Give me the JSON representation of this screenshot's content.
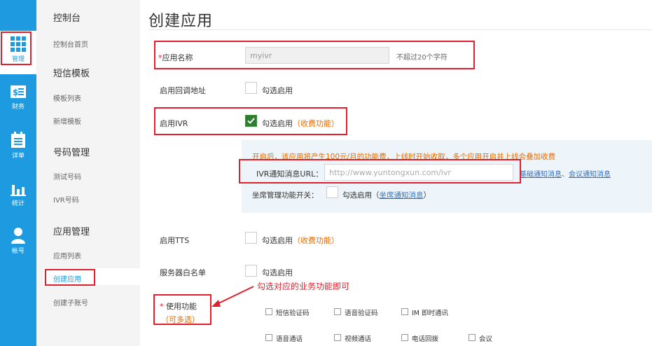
{
  "rail": {
    "items": [
      {
        "label": "管理",
        "icon": "grid-icon"
      },
      {
        "label": "财务",
        "icon": "bill-icon"
      },
      {
        "label": "详单",
        "icon": "list-icon"
      },
      {
        "label": "统计",
        "icon": "bar-chart-icon"
      },
      {
        "label": "帐号",
        "icon": "user-icon"
      }
    ]
  },
  "subnav": {
    "groups": [
      {
        "title": "控制台",
        "items": [
          "控制台首页"
        ]
      },
      {
        "title": "短信模板",
        "items": [
          "模板列表",
          "新增模板"
        ]
      },
      {
        "title": "号码管理",
        "items": [
          "测试号码",
          "IVR号码"
        ]
      },
      {
        "title": "应用管理",
        "items": [
          "应用列表",
          "创建应用",
          "创建子账号"
        ]
      }
    ]
  },
  "page": {
    "title": "创建应用"
  },
  "form": {
    "app_name": {
      "req": "*",
      "label": "应用名称",
      "value": "myivr",
      "hint": "不超过20个字符"
    },
    "callback": {
      "label": "启用回调地址",
      "option": "勾选启用"
    },
    "ivr": {
      "label": "启用IVR",
      "option": "勾选启用",
      "open": "（",
      "fee": "收费功能",
      "close": "）"
    },
    "ivr_panel": {
      "notice": "开启后，该应用将产生100元/月的功能费，上线时开始收取，多个应用开启并上线会叠加收费",
      "url_label": "IVR通知消息URL：",
      "url_placeholder": "http://www.yuntongxun.com/ivr",
      "link1": "基础通知消息",
      "sep": "、",
      "link2": "会议通知消息",
      "seat_label": "坐席管理功能开关：",
      "seat_option": "勾选启用",
      "seat_open": "（",
      "seat_link": "坐席通知消息",
      "seat_close": "）"
    },
    "tts": {
      "label": "启用TTS",
      "option": "勾选启用",
      "open": "（",
      "fee": "收费功能",
      "close": "）"
    },
    "whitelist": {
      "label": "服务器白名单",
      "option": "勾选启用"
    },
    "functions": {
      "req": "*",
      "label": "使用功能",
      "open": "（",
      "multi": "可多选",
      "close": "）"
    }
  },
  "annotation": {
    "text": "勾选对应的业务功能即可"
  },
  "services": [
    "短信验证码",
    "语音验证码",
    "IM 即时通讯",
    "语音通话",
    "视频通话",
    "电话回拨",
    "会议"
  ],
  "colors": {
    "accent": "#1e9be0",
    "highlight": "#e0202c",
    "fee": "#e86c00",
    "panel": "#edf5fa"
  }
}
